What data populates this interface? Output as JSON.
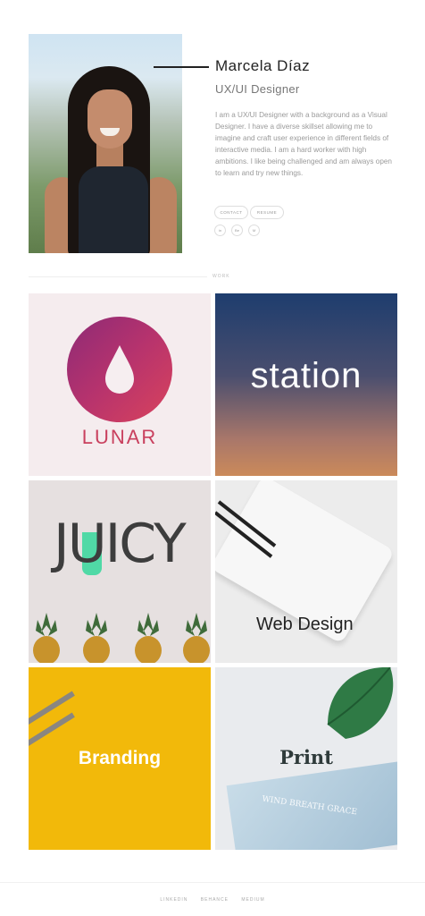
{
  "profile": {
    "name": "Marcela Díaz",
    "role": "UX/UI Designer",
    "bio": "I am a UX/UI Designer with a background as a Visual Designer. I have a diverse skillset allowing me to imagine and craft user experience in different fields of interactive media. I am a hard worker with high ambitions. I like being challenged and am always open to learn and try new things.",
    "buttons": {
      "contact": "CONTACT",
      "resume": "RESUME"
    },
    "social": [
      {
        "icon": "linkedin-icon",
        "label": "in"
      },
      {
        "icon": "behance-icon",
        "label": "Be"
      },
      {
        "icon": "medium-icon",
        "label": "M"
      }
    ]
  },
  "section": {
    "label": "WORK"
  },
  "projects": [
    {
      "title": "LUNAR"
    },
    {
      "title": "station"
    },
    {
      "title": "JUICY"
    },
    {
      "title": "Web Design"
    },
    {
      "title": "Branding"
    },
    {
      "title": "Print"
    }
  ],
  "print_tile": {
    "booklet_text": "WIND BREATH GRACE"
  },
  "footer": {
    "links": [
      "LINKEDIN",
      "BEHANCE",
      "MEDIUM"
    ]
  },
  "colors": {
    "accent_lunar": "#c9405e",
    "juicy_green": "#3fd8a0",
    "branding_yellow": "#f2b90a"
  }
}
